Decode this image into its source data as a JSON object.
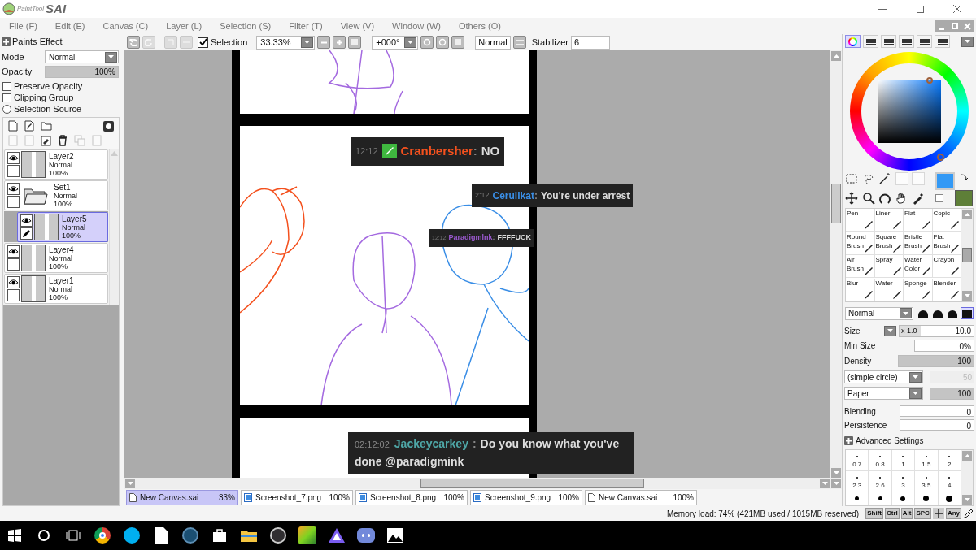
{
  "app": {
    "logo_small": "PaintTool",
    "logo_big": "SAI"
  },
  "menu": [
    {
      "label": "File (F)"
    },
    {
      "label": "Edit (E)"
    },
    {
      "label": "Canvas (C)"
    },
    {
      "label": "Layer (L)"
    },
    {
      "label": "Selection (S)"
    },
    {
      "label": "Filter (T)"
    },
    {
      "label": "View (V)"
    },
    {
      "label": "Window (W)"
    },
    {
      "label": "Others (O)"
    }
  ],
  "left_panel": {
    "paints_effect": "Paints Effect",
    "mode_label": "Mode",
    "mode_value": "Normal",
    "opacity_label": "Opacity",
    "opacity": {
      "value": "100%",
      "level": 1.0
    },
    "options": [
      {
        "label": "Preserve Opacity",
        "kind": "checkbox",
        "checked": false
      },
      {
        "label": "Clipping Group",
        "kind": "checkbox",
        "checked": false
      },
      {
        "label": "Selection Source",
        "kind": "radio",
        "checked": false
      }
    ]
  },
  "layers": [
    {
      "name": "Layer2",
      "mode": "Normal",
      "opacity": "100%",
      "kind": "layer",
      "visible": true,
      "selected": false
    },
    {
      "name": "Set1",
      "mode": "Normal",
      "opacity": "100%",
      "kind": "folder",
      "visible": true,
      "selected": false,
      "children": [
        {
          "name": "Layer5",
          "mode": "Normal",
          "opacity": "100%",
          "kind": "layer",
          "visible": true,
          "selected": true
        }
      ]
    },
    {
      "name": "Layer4",
      "mode": "Normal",
      "opacity": "100%",
      "kind": "layer",
      "visible": true,
      "selected": false
    },
    {
      "name": "Layer1",
      "mode": "Normal",
      "opacity": "100%",
      "kind": "layer",
      "visible": true,
      "selected": false
    }
  ],
  "toolbar": {
    "selection_label": "Selection",
    "selection_checked": true,
    "zoom": "33.33%",
    "rotation": "+000°",
    "blend": "Normal",
    "stabilizer_label": "Stabilizer",
    "stabilizer": "6"
  },
  "canvas": {
    "messages": [
      {
        "time": "12:12",
        "user": "Cranbersher",
        "separator": ":",
        "text": "NO",
        "color": "#f4511e",
        "kind": "large"
      },
      {
        "time": "2:12",
        "user": "Cerulikat",
        "separator": ":",
        "text": "You're under arrest",
        "color": "#3a8ee6",
        "kind": "medium"
      },
      {
        "time": "12:12",
        "user": "Paradigmlnk",
        "separator": ":",
        "text": "FFFFUCK",
        "color": "#9b59d0",
        "kind": "small"
      },
      {
        "time": "02:12:02",
        "user": "Jackeycarkey",
        "separator": ":",
        "text": "Do you know what you've done @paradigmink",
        "color": "#4ea6a6",
        "kind": "wide"
      }
    ]
  },
  "tabs": [
    {
      "label": "New Canvas.sai",
      "zoom": "33%",
      "kind": "canvas",
      "selected": true
    },
    {
      "label": "Screenshot_7.png",
      "zoom": "100%",
      "kind": "image",
      "selected": false
    },
    {
      "label": "Screenshot_8.png",
      "zoom": "100%",
      "kind": "image",
      "selected": false
    },
    {
      "label": "Screenshot_9.png",
      "zoom": "100%",
      "kind": "image",
      "selected": false
    },
    {
      "label": "New Canvas.sai",
      "zoom": "100%",
      "kind": "canvas",
      "selected": false
    }
  ],
  "status": {
    "memory": "Memory load: 74% (421MB used / 1015MB reserved)",
    "keys": [
      {
        "label": "Shift",
        "kind": "key"
      },
      {
        "label": "Ctrl",
        "kind": "key"
      },
      {
        "label": "Alt",
        "kind": "key"
      },
      {
        "label": "SPC",
        "kind": "key"
      },
      {
        "kind": "move"
      },
      {
        "label": "Any",
        "kind": "key"
      },
      {
        "kind": "pen"
      }
    ]
  },
  "right_panel": {
    "color_tabs": [
      {
        "selected": true
      },
      {
        "selected": false
      },
      {
        "selected": false
      },
      {
        "selected": false
      },
      {
        "selected": false
      },
      {
        "selected": false
      }
    ],
    "swatches": [
      {
        "color": "#3399f5"
      },
      {
        "color": "#5e7f38"
      }
    ],
    "brushes": [
      {
        "label": "Pen"
      },
      {
        "label": "Liner"
      },
      {
        "label": "Flat"
      },
      {
        "label": "Copic"
      },
      {
        "label": "Round Brush"
      },
      {
        "label": "Square Brush"
      },
      {
        "label": "Bristle Brush"
      },
      {
        "label": "Flat Brush"
      },
      {
        "label": "Air Brush"
      },
      {
        "label": "Spray"
      },
      {
        "label": "Water Color"
      },
      {
        "label": "Crayon"
      },
      {
        "label": "Blur"
      },
      {
        "label": "Water"
      },
      {
        "label": "Sponge"
      },
      {
        "label": "Blender"
      }
    ],
    "brush_mode": "Normal",
    "tip_shapes": [
      {
        "selected": false
      },
      {
        "selected": false
      },
      {
        "selected": false
      },
      {
        "selected": true
      }
    ],
    "size_label": "Size",
    "size_multiplier": "x 1.0",
    "size_value": "10.0",
    "min_size_label": "Min Size",
    "min_size_value": "0%",
    "density_label": "Density",
    "density": {
      "value": "100",
      "level": 1.0
    },
    "shape": "(simple circle)",
    "shape_value": "50",
    "texture": "Paper",
    "texture_strength": {
      "value": "100",
      "level": 1.0
    },
    "blending_label": "Blending",
    "blending_value": "0",
    "persistence_label": "Persistence",
    "persistence_value": "0",
    "advanced": "Advanced Settings",
    "sizes": [
      "0.7",
      "0.8",
      "1",
      "1.5",
      "2",
      "2.3",
      "2.6",
      "3",
      "3.5",
      "4"
    ]
  }
}
